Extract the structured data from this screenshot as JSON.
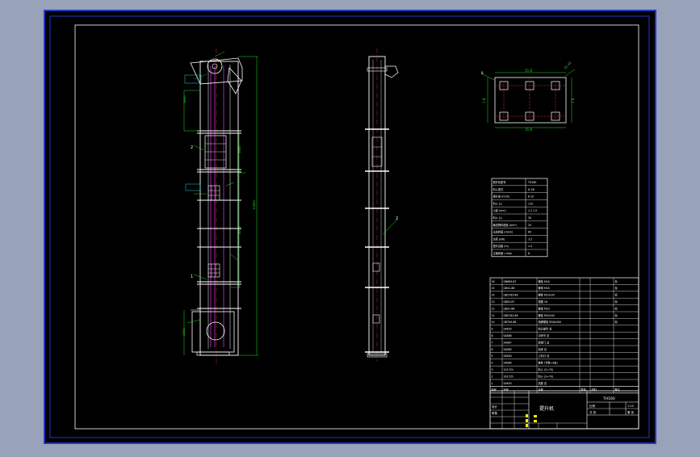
{
  "colors": {
    "viewport_bg": "#98a2b8",
    "sheet_bg": "#000000",
    "sheet_border": "#2436c8",
    "frame": "#ffffff",
    "geometry": "#ffffff",
    "chain": "#e040e0",
    "dimension": "#22dd22",
    "centerline": "#ff3030",
    "cyan": "#28d8d8",
    "yellow": "#f2f200"
  },
  "side_view": {
    "balloon_2": "2",
    "balloon_1": "1"
  },
  "plan_view": {
    "dim_top": "15 8",
    "dim_bottom": "15 8",
    "dim_left": "1 8",
    "dim_right": "1 8",
    "note_left": "8",
    "note_right": "20 40"
  },
  "spec_table": {
    "rows": [
      [
        "提升机型号",
        "TH160"
      ],
      [
        "料斗型式",
        "D  ZH"
      ],
      [
        "提升量 (m³/h)",
        "8  10"
      ],
      [
        "料斗 (L)",
        "110"
      ],
      [
        "斗距 (mm)",
        "1.2  1.5"
      ],
      [
        "料斗 (L)",
        "30"
      ],
      [
        "输送物料密度 (t/m³)",
        "20"
      ],
      [
        "头轮转速 (r/min)",
        "60"
      ],
      [
        "功率 (kW)",
        "3.5"
      ],
      [
        "提升高度 (m)",
        "1.4"
      ],
      [
        "主轴转速 / ratio",
        "8"
      ]
    ]
  },
  "parts_list": {
    "rows": [
      {
        "no": "16",
        "code": "GB669-87",
        "name": "螺栓 M16",
        "qty": "",
        "mat": "",
        "note": "标"
      },
      {
        "no": "15",
        "code": "GB41-86",
        "name": "螺母 M16",
        "qty": "",
        "mat": "",
        "note": "标"
      },
      {
        "no": "14",
        "code": "GB5783-86",
        "name": "螺栓 M10x30",
        "qty": "",
        "mat": "",
        "note": "标"
      },
      {
        "no": "13",
        "code": "GB93-87",
        "name": "垫圈 16",
        "qty": "",
        "mat": "",
        "note": "标"
      },
      {
        "no": "12",
        "code": "GB41-86",
        "name": "螺母 M10",
        "qty": "",
        "mat": "",
        "note": "标"
      },
      {
        "no": "11",
        "code": "GB5782-86",
        "name": "螺栓 M10x30",
        "qty": "",
        "mat": "",
        "note": "标"
      },
      {
        "no": "10",
        "code": "GB799-88",
        "name": "地脚螺栓 M16x300",
        "qty": "",
        "mat": "",
        "note": "标"
      },
      {
        "no": "9",
        "code": "S4820",
        "name": "机头部件 总",
        "qty": "",
        "mat": "",
        "note": ""
      },
      {
        "no": "8",
        "code": "S4886",
        "name": "中间节 总",
        "qty": "",
        "mat": "",
        "note": ""
      },
      {
        "no": "7",
        "code": "S4887",
        "name": "检视门 总",
        "qty": "",
        "mat": "",
        "note": ""
      },
      {
        "no": "6",
        "code": "S4885",
        "name": "机壳 总",
        "qty": "",
        "mat": "",
        "note": ""
      },
      {
        "no": "5",
        "code": "S4890",
        "name": "上料口 总",
        "qty": "",
        "mat": "",
        "note": ""
      },
      {
        "no": "4",
        "code": "S4884",
        "name": "链条 (节数=4米)",
        "qty": "",
        "mat": "",
        "note": ""
      },
      {
        "no": "3",
        "code": "10172h",
        "name": "料斗 (2=70)",
        "qty": "",
        "mat": "",
        "note": ""
      },
      {
        "no": "2",
        "code": "16172h",
        "name": "料斗 (2=70)",
        "qty": "",
        "mat": "",
        "note": ""
      },
      {
        "no": "1",
        "code": "S4850",
        "name": "机座 总",
        "qty": "",
        "mat": "",
        "note": ""
      }
    ],
    "header": {
      "no": "序号",
      "code": "代号",
      "name": "名称",
      "qty": "数量",
      "mat": "材料",
      "note": "备注"
    }
  },
  "title_block": {
    "drawing_title": "提升机",
    "code": "TH160",
    "scale_label": "比例",
    "scale_value": "1:15",
    "sheet_label": "共 张",
    "sheet_value": "第 张",
    "designer_label": "设计",
    "checker_label": "审核"
  }
}
